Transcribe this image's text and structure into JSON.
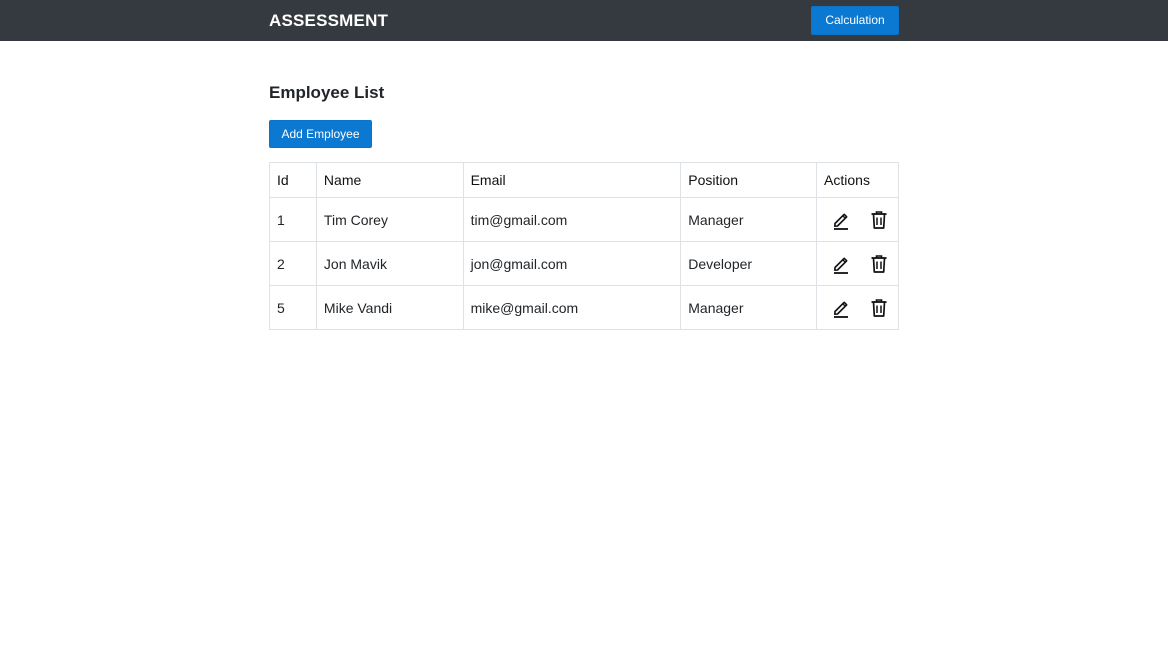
{
  "navbar": {
    "brand": "ASSESSMENT",
    "calc_label": "Calculation"
  },
  "page": {
    "title": "Employee List",
    "add_label": "Add Employee"
  },
  "table": {
    "headers": [
      "Id",
      "Name",
      "Email",
      "Position",
      "Actions"
    ],
    "rows": [
      {
        "id": "1",
        "name": "Tim Corey",
        "email": "tim@gmail.com",
        "position": "Manager"
      },
      {
        "id": "2",
        "name": "Jon Mavik",
        "email": "jon@gmail.com",
        "position": "Developer"
      },
      {
        "id": "5",
        "name": "Mike Vandi",
        "email": "mike@gmail.com",
        "position": "Manager"
      }
    ],
    "row_icons": [
      "pencil-icon",
      "trash-icon"
    ]
  },
  "colors": {
    "navbar_bg": "#343a40",
    "primary": "#0b78d1",
    "border": "#dee2e6"
  }
}
